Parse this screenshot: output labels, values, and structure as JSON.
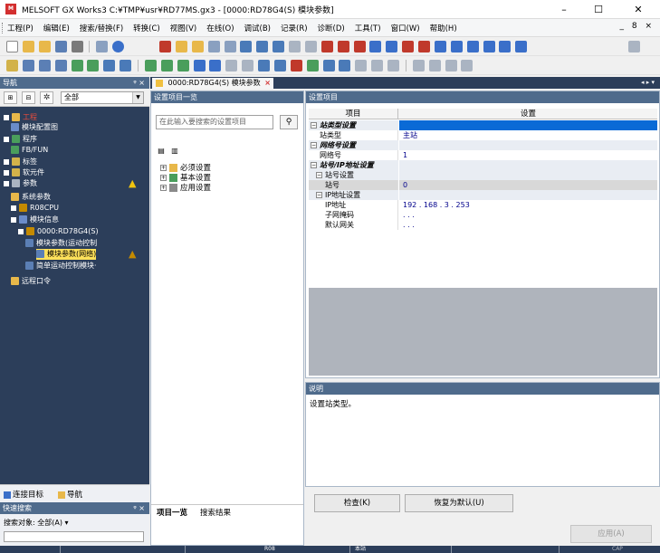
{
  "window": {
    "title": "MELSOFT GX Works3 C:¥TMP¥usr¥RD77MS.gx3 - [0000:RD78G4(S) 模块参数]",
    "app_icon": "MELSOFT-logo-icon",
    "controls": {
      "minimize": "–",
      "maximize": "☐",
      "close": "✕"
    },
    "mdi_controls": "_ 8 ×"
  },
  "menu": {
    "items": [
      "工程(P)",
      "编辑(E)",
      "搜索/替换(F)",
      "转换(C)",
      "视图(V)",
      "在线(O)",
      "调试(B)",
      "记录(R)",
      "诊断(D)",
      "工具(T)",
      "窗口(W)",
      "帮助(H)"
    ]
  },
  "navigation": {
    "header": "导航",
    "header_controls": "ᵠ ×",
    "filter_select": "全部",
    "tree": [
      {
        "label": "工程",
        "level": 0
      },
      {
        "label": "模块配置图",
        "level": 1
      },
      {
        "label": "程序",
        "level": 0
      },
      {
        "label": "FB/FUN",
        "level": 1
      },
      {
        "label": "标签",
        "level": 0
      },
      {
        "label": "软元件",
        "level": 0
      },
      {
        "label": "参数",
        "level": 0
      },
      {
        "label": "系统参数",
        "level": 1
      },
      {
        "label": "R08CPU",
        "level": 1
      },
      {
        "label": "模块信息",
        "level": 1
      },
      {
        "label": "0000:RD78G4(S)",
        "level": 2
      },
      {
        "label": "模块参数(运动控制",
        "level": 3
      },
      {
        "label": "模块参数(网络)",
        "level": 3,
        "selected": true
      },
      {
        "label": "简单运动控制模块·",
        "level": 3
      },
      {
        "label": "远程口令",
        "level": 1
      }
    ],
    "bottom_tabs": [
      "连接目标",
      "导航"
    ]
  },
  "quick_search": {
    "header": "快速搜索",
    "header_controls": "ᵠ ×",
    "target_label": "搜索对象: 全部(A) ▾"
  },
  "document_tab": {
    "label": "0000:RD78G4(S) 模块参数",
    "close": "×",
    "scroll_controls": "◂ ▸ ▾"
  },
  "setting_list": {
    "header": "设置项目一览",
    "search_placeholder": "在此输入要搜索的设置项目",
    "search_button_icon": "binoculars-icon",
    "tree": [
      {
        "label": "必须设置",
        "state": "+"
      },
      {
        "label": "基本设置",
        "state": "+"
      },
      {
        "label": "应用设置",
        "state": "+"
      }
    ],
    "tabs": [
      "项目一览",
      "搜索结果"
    ]
  },
  "setting_grid": {
    "header": "设置项目",
    "columns": [
      "项目",
      "设置"
    ],
    "rows": [
      {
        "kind": "category",
        "label": "站类型设置",
        "value": "",
        "indent": 0
      },
      {
        "kind": "item",
        "label": "站类型",
        "value": "主站",
        "indent": 2
      },
      {
        "kind": "category",
        "label": "网络号设置",
        "value": "",
        "indent": 0
      },
      {
        "kind": "item",
        "label": "网络号",
        "value": "1",
        "indent": 2
      },
      {
        "kind": "category",
        "label": "站号/IP地址设置",
        "value": "",
        "indent": 0
      },
      {
        "kind": "subcat",
        "label": "站号设置",
        "value": "",
        "indent": 1
      },
      {
        "kind": "item",
        "label": "站号",
        "value": "0",
        "indent": 3
      },
      {
        "kind": "subcat",
        "label": "IP地址设置",
        "value": "",
        "indent": 1
      },
      {
        "kind": "item",
        "label": "IP地址",
        "value": "192 . 168 .  3 . 253",
        "indent": 3
      },
      {
        "kind": "item",
        "label": "子网掩码",
        "value": ".  .  .",
        "indent": 3
      },
      {
        "kind": "item",
        "label": "默认网关",
        "value": ".  .  .",
        "indent": 3
      }
    ]
  },
  "explanation": {
    "header": "说明",
    "text": "设置站类型。"
  },
  "buttons": {
    "check": "检查(K)",
    "restore_default": "恢复为默认(U)",
    "apply": "应用(A)"
  },
  "status_bar": {
    "cpu": "R08",
    "station": "本站",
    "mode": "CAP"
  },
  "colors": {
    "navigation_background": "#2c3e5a",
    "pane_header": "#4f6b8c",
    "selected_tree_item": "#ffe15a",
    "selected_grid_cell": "#0a6ad6",
    "warning": "#f1c40f",
    "value_text": "#00008b"
  }
}
